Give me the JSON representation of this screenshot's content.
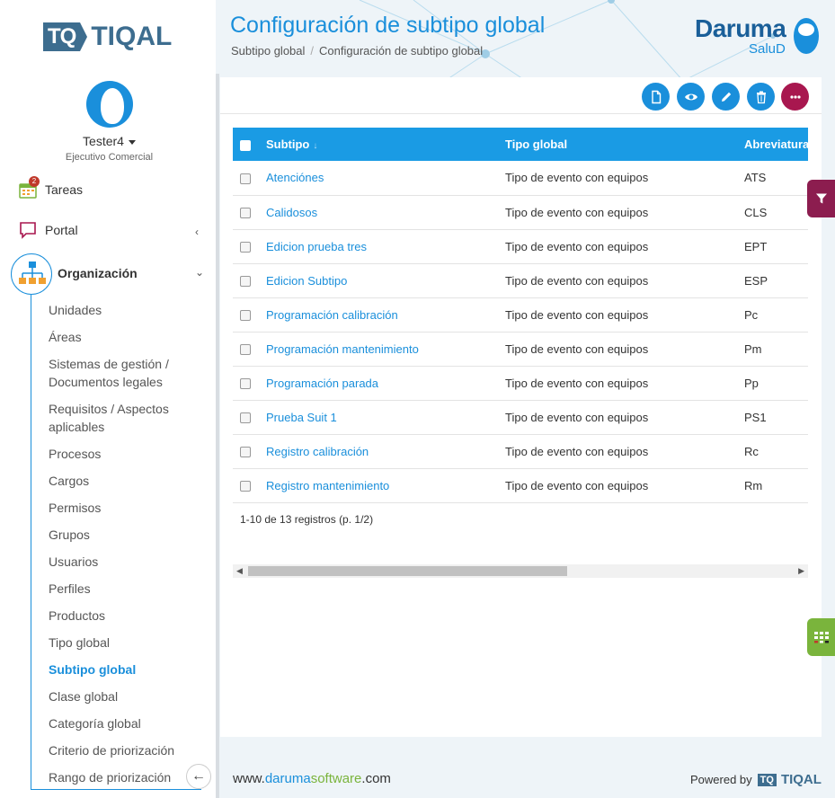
{
  "brand": {
    "logo_mark": "TQ",
    "logo_text": "TIQAL"
  },
  "user": {
    "name": "Tester4",
    "role": "Ejecutivo Comercial"
  },
  "nav": {
    "tareas": {
      "label": "Tareas",
      "badge": "2"
    },
    "portal": {
      "label": "Portal"
    },
    "organizacion": {
      "label": "Organización"
    },
    "sub_items": [
      "Unidades",
      "Áreas",
      "Sistemas de gestión / Documentos legales",
      "Requisitos / Aspectos aplicables",
      "Procesos",
      "Cargos",
      "Permisos",
      "Grupos",
      "Usuarios",
      "Perfiles",
      "Productos",
      "Tipo global",
      "Subtipo global",
      "Clase global",
      "Categoría global",
      "Criterio de priorización",
      "Rango de priorización"
    ],
    "active_item": "Subtipo global"
  },
  "header": {
    "title": "Configuración de subtipo global",
    "breadcrumb": [
      "Subtipo global",
      "Configuración de subtipo global"
    ],
    "partner_logo": {
      "name": "Daruma",
      "sub": "SaluD"
    }
  },
  "toolbar": {
    "buttons": [
      "new-document-icon",
      "view-eye-icon",
      "edit-pencil-icon",
      "delete-trash-icon",
      "more-options-icon"
    ]
  },
  "table": {
    "columns": [
      "Subtipo",
      "Tipo global",
      "Abreviatura"
    ],
    "rows": [
      {
        "subtipo": "Atenciónes",
        "tipo": "Tipo de evento con equipos",
        "abrev": "ATS"
      },
      {
        "subtipo": "Calidosos",
        "tipo": "Tipo de evento con equipos",
        "abrev": "CLS"
      },
      {
        "subtipo": "Edicion prueba tres",
        "tipo": "Tipo de evento con equipos",
        "abrev": "EPT"
      },
      {
        "subtipo": "Edicion Subtipo",
        "tipo": "Tipo de evento con equipos",
        "abrev": "ESP"
      },
      {
        "subtipo": "Programación calibración",
        "tipo": "Tipo de evento con equipos",
        "abrev": "Pc"
      },
      {
        "subtipo": "Programación mantenimiento",
        "tipo": "Tipo de evento con equipos",
        "abrev": "Pm"
      },
      {
        "subtipo": "Programación parada",
        "tipo": "Tipo de evento con equipos",
        "abrev": "Pp"
      },
      {
        "subtipo": "Prueba Suit 1",
        "tipo": "Tipo de evento con equipos",
        "abrev": "PS1"
      },
      {
        "subtipo": "Registro calibración",
        "tipo": "Tipo de evento con equipos",
        "abrev": "Rc"
      },
      {
        "subtipo": "Registro mantenimiento",
        "tipo": "Tipo de evento con equipos",
        "abrev": "Rm"
      }
    ],
    "pager": "1-10 de 13 registros (p. 1/2)"
  },
  "footer": {
    "url_prefix": "www.",
    "url_brand1": "daruma",
    "url_brand2": "software",
    "url_suffix": ".com",
    "powered_label": "Powered by",
    "powered_mark": "TQ",
    "powered_text": "TIQAL"
  },
  "colors": {
    "primary": "#1a8fdb",
    "header_row": "#1a9be4",
    "more_button": "#a8174f",
    "filter_tab": "#8c1d4f",
    "grid_tab": "#7ab43c",
    "logo": "#3d6d8f"
  }
}
